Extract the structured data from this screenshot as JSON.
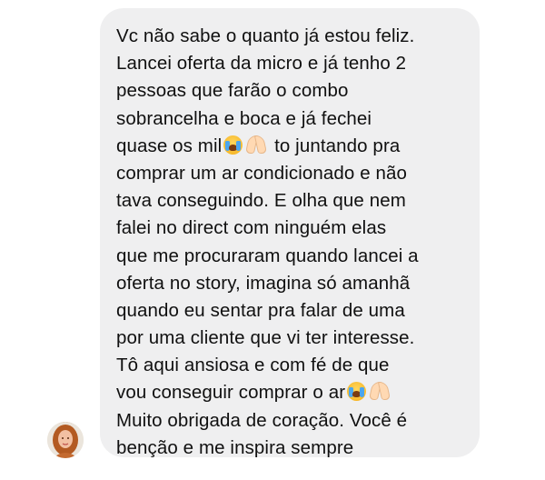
{
  "message": {
    "lines": [
      "Vc não sabe o quanto já estou feliz.",
      "Lancei oferta da micro e já tenho 2",
      "pessoas que farão o combo",
      "sobrancelha e boca e já fechei",
      "quase os mil",
      " to juntando pra",
      "comprar um ar condicionado e não",
      "tava conseguindo. E olha que nem",
      "falei no direct com ninguém elas",
      "que me procuraram quando lancei a",
      "oferta no story, imagina só amanhã",
      "quando eu sentar pra falar de uma",
      "por uma cliente que vi ter interesse.",
      "Tô aqui ansiosa e com fé de que",
      "vou conseguir comprar o ar",
      "Muito obrigada de coração. Você é",
      "benção e me inspira sempre"
    ],
    "emoji_after_line_5": [
      "crying-face-icon",
      "folded-hands-icon"
    ],
    "emoji_after_line_15": [
      "crying-face-icon",
      "folded-hands-icon"
    ]
  },
  "colors": {
    "bubble_background": "#efeff0",
    "text": "#101010",
    "page_background": "#ffffff"
  },
  "sender": {
    "avatar_icon": "profile-photo"
  }
}
